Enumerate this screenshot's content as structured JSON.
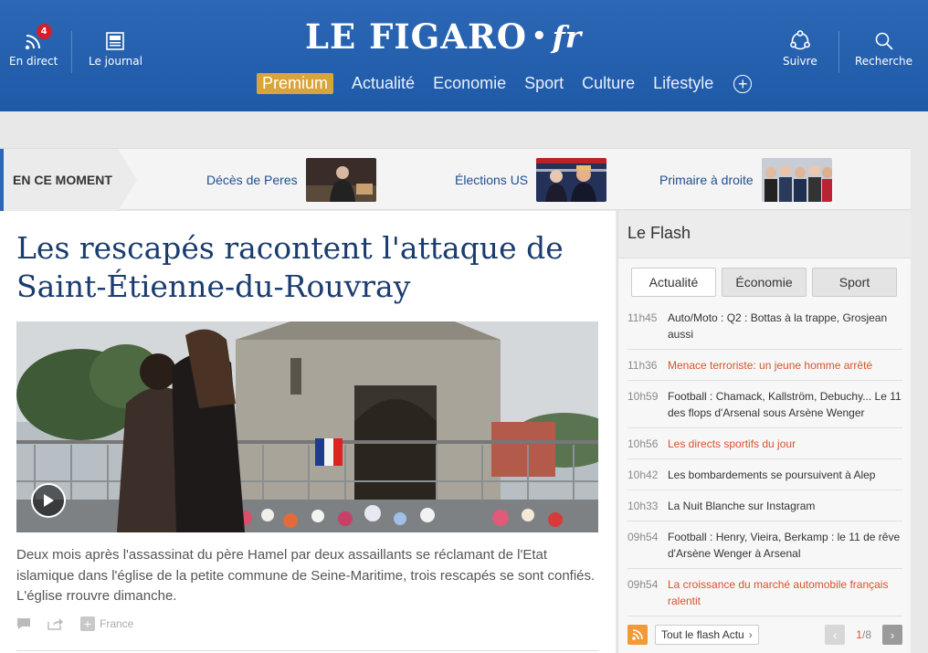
{
  "header": {
    "live_label": "En direct",
    "live_count": "4",
    "journal_label": "Le journal",
    "logo_main": "LE FIGARO",
    "logo_dot": "•",
    "logo_fr": "fr",
    "follow_label": "Suivre",
    "search_label": "Recherche",
    "nav": [
      "Premium",
      "Actualité",
      "Economie",
      "Sport",
      "Culture",
      "Lifestyle"
    ],
    "nav_plus": "+"
  },
  "moment": {
    "label": "EN CE MOMENT",
    "items": [
      {
        "label": "Décès de Peres"
      },
      {
        "label": "Élections US"
      },
      {
        "label": "Primaire à droite"
      }
    ]
  },
  "article": {
    "title": "Les rescapés racontent l'attaque de Saint-Étienne-du-Rouvray",
    "lede": "Deux mois après l'assassinat du père Hamel par deux assaillants se réclamant de l'Etat islamique dans l'église de la petite commune de Seine-Maritime, trois rescapés se sont confiés. L'église rrouvre dimanche.",
    "tag": "France"
  },
  "flash": {
    "title": "Le Flash",
    "tabs": [
      "Actualité",
      "Économie",
      "Sport"
    ],
    "items": [
      {
        "time": "11h45",
        "text": "Auto/Moto : Q2 : Bottas à la trappe, Grosjean aussi",
        "hot": false
      },
      {
        "time": "11h36",
        "text": "Menace terroriste: un jeune homme arrêté",
        "hot": true
      },
      {
        "time": "10h59",
        "text": "Football : Chamack, Kallström, Debuchy... Le 11 des flops d'Arsenal sous Arsène Wenger",
        "hot": false
      },
      {
        "time": "10h56",
        "text": "Les directs sportifs du jour",
        "hot": true
      },
      {
        "time": "10h42",
        "text": "Les bombardements se poursuivent à Alep",
        "hot": false
      },
      {
        "time": "10h33",
        "text": "La Nuit Blanche sur Instagram",
        "hot": false
      },
      {
        "time": "09h54",
        "text": "Football : Henry, Vieira, Berkamp : le 11 de rêve d'Arsène Wenger à Arsenal",
        "hot": false
      },
      {
        "time": "09h54",
        "text": "La croissance du marché automobile français ralentit",
        "hot": true
      }
    ],
    "all_label": "Tout le flash Actu",
    "page_current": "1",
    "page_total": "/8"
  }
}
